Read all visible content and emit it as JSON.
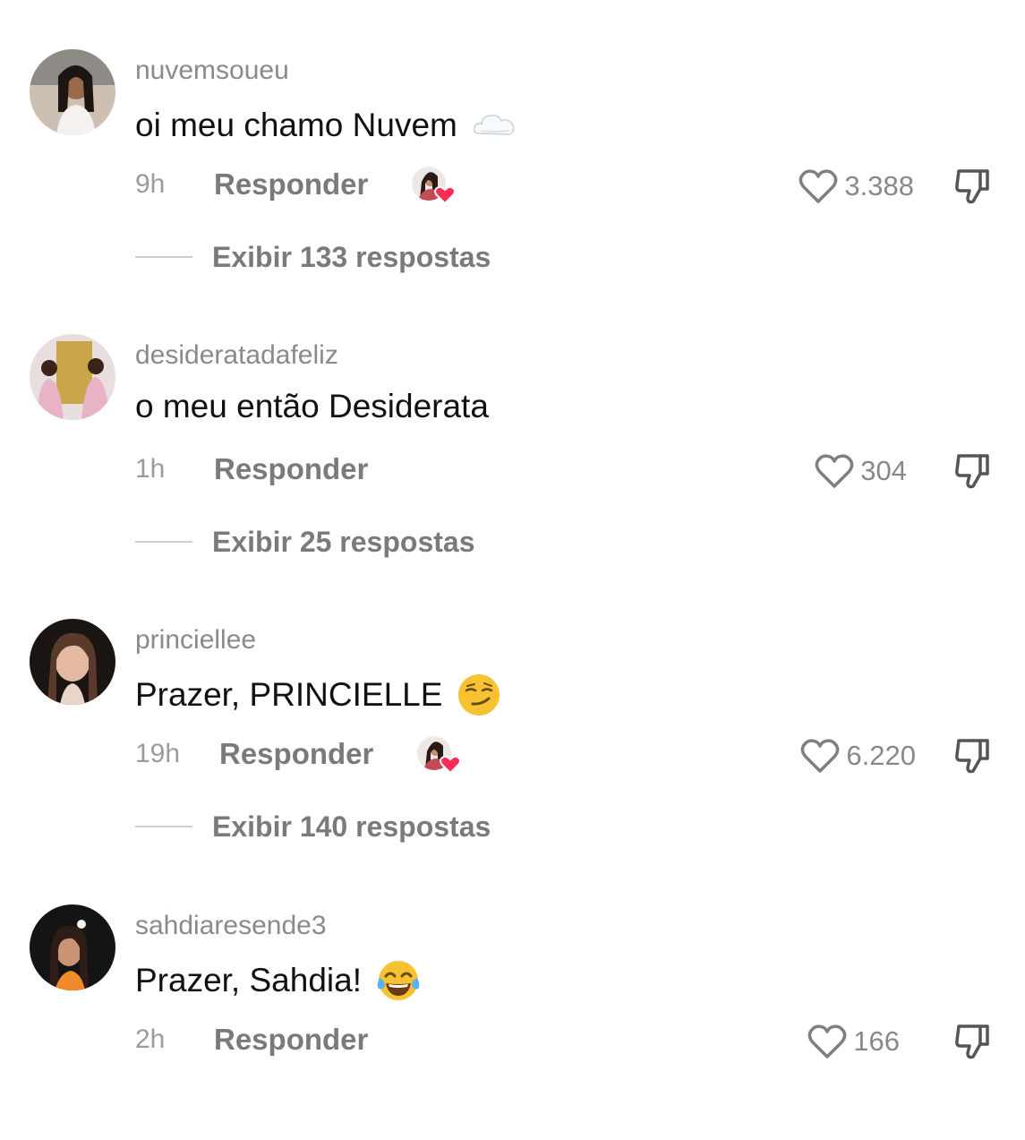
{
  "comments": [
    {
      "username": "nuvemsoueu",
      "text": "oi meu chamo Nuvem",
      "emoji": "cloud-emoji",
      "time": "9h",
      "reply_label": "Responder",
      "creator_liked": true,
      "likes": "3.388",
      "replies_label": "Exibir 133 respostas"
    },
    {
      "username": "desideratadafeliz",
      "text": "o meu então Desiderata",
      "emoji": "",
      "time": "1h",
      "reply_label": "Responder",
      "creator_liked": false,
      "likes": "304",
      "replies_label": "Exibir 25 respostas"
    },
    {
      "username": "princiellee",
      "text": "Prazer, PRINCIELLE",
      "emoji": "smirking-face-emoji",
      "time": "19h",
      "reply_label": "Responder",
      "creator_liked": true,
      "likes": "6.220",
      "replies_label": "Exibir 140 respostas"
    },
    {
      "username": "sahdiaresende3",
      "text": "Prazer, Sahdia!",
      "emoji": "tears-of-joy-emoji",
      "time": "2h",
      "reply_label": "Responder",
      "creator_liked": false,
      "likes": "166",
      "replies_label": ""
    }
  ],
  "colors": {
    "heart_red": "#fe2c55",
    "meta_gray": "#7a7a7a",
    "username_gray": "#8a8a8a"
  }
}
